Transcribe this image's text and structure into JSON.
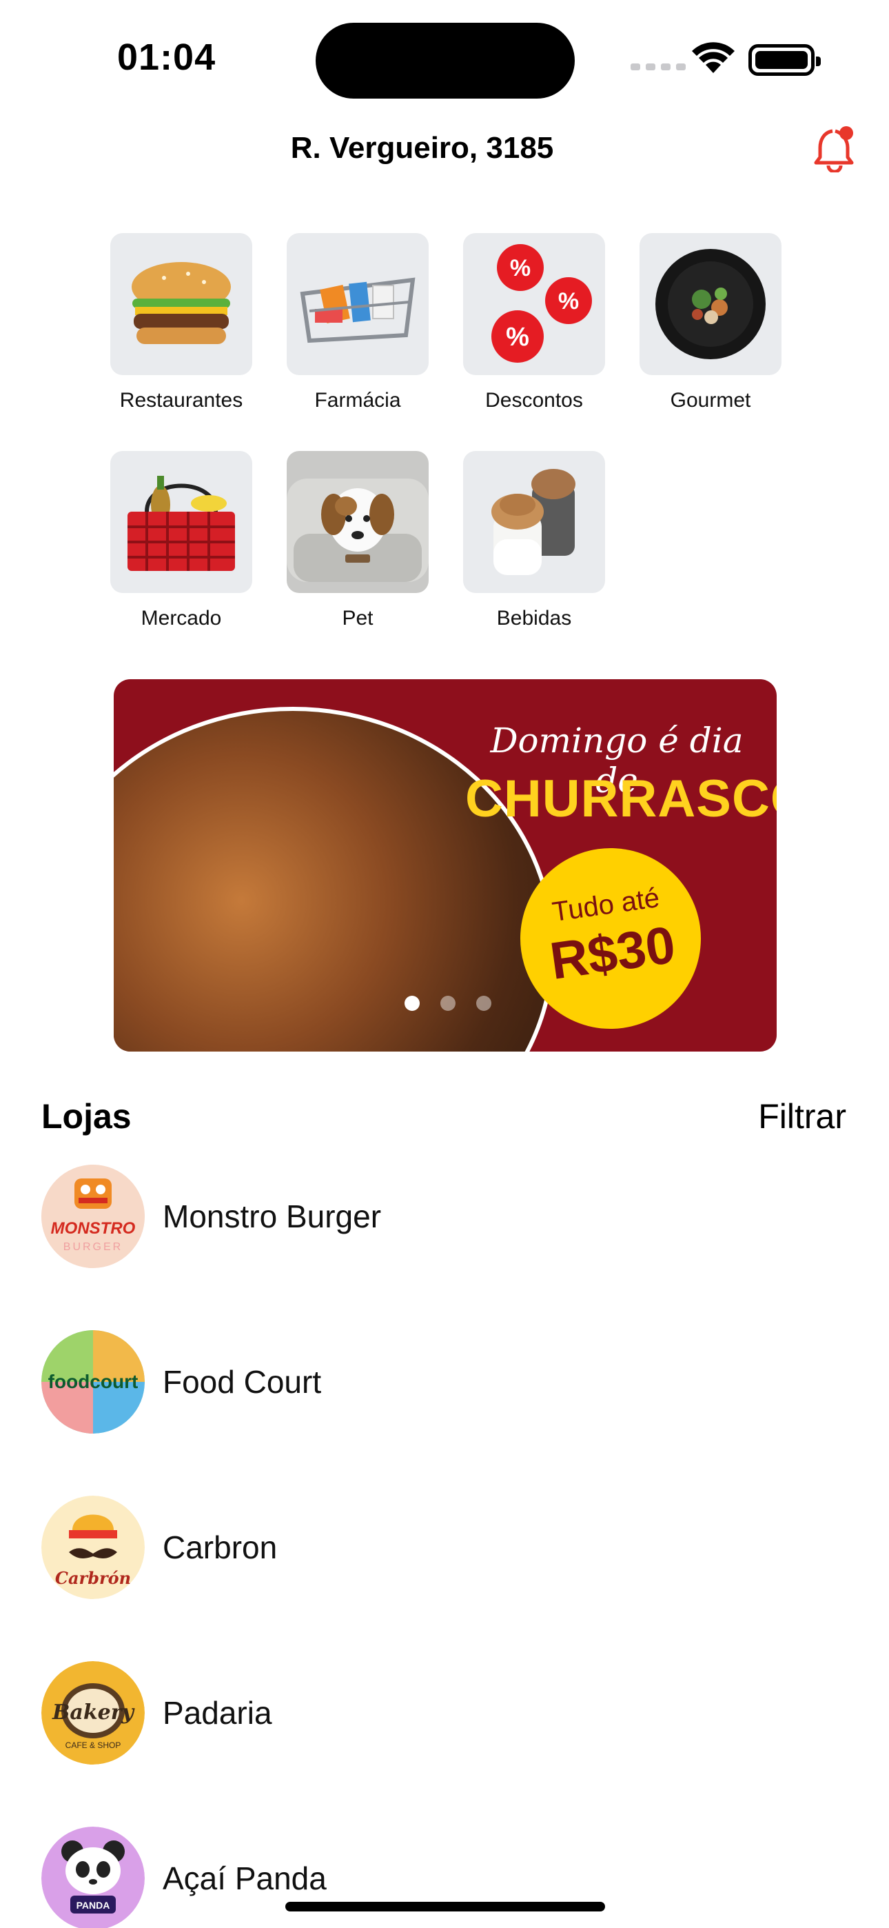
{
  "status_bar": {
    "time": "01:04"
  },
  "header": {
    "address": "R. Vergueiro, 3185"
  },
  "categories": [
    {
      "label": "Restaurantes",
      "icon": "burger-icon"
    },
    {
      "label": "Farmácia",
      "icon": "pharmacy-basket-icon"
    },
    {
      "label": "Descontos",
      "icon": "discount-balloons-icon"
    },
    {
      "label": "Gourmet",
      "icon": "gourmet-plate-icon"
    },
    {
      "label": "Mercado",
      "icon": "market-basket-icon"
    },
    {
      "label": "Pet",
      "icon": "pet-dog-icon"
    },
    {
      "label": "Bebidas",
      "icon": "drinks-icon"
    }
  ],
  "banner": {
    "line1": "Domingo é dia de",
    "line2": "CHURRASCO",
    "badge_line1": "Tudo até",
    "badge_line2": "R$30",
    "page_count": 3,
    "active_page": 1
  },
  "stores_section": {
    "title": "Lojas",
    "filter_label": "Filtrar"
  },
  "stores": [
    {
      "name": "Monstro Burger",
      "logo_text": "MONSTRO",
      "logo_bg": "#f7d9c8",
      "logo_color": "#d42a1f"
    },
    {
      "name": "Food Court",
      "logo_text": "foodcourt",
      "logo_bg": "#7ccfa7",
      "logo_color": "#0d5a2f"
    },
    {
      "name": "Carbron",
      "logo_text": "Carbrón",
      "logo_bg": "#fcecc4",
      "logo_color": "#b0281d"
    },
    {
      "name": "Padaria",
      "logo_text": "Bakery",
      "logo_bg": "#f2b630",
      "logo_color": "#3b2a1a"
    },
    {
      "name": "Açaí Panda",
      "logo_text": "PANDA",
      "logo_bg": "#d9a0e8",
      "logo_color": "#2a1a5e"
    }
  ],
  "colors": {
    "accent": "#e8372b",
    "banner_bg": "#8e0f1c",
    "banner_yellow": "#ffd000"
  }
}
